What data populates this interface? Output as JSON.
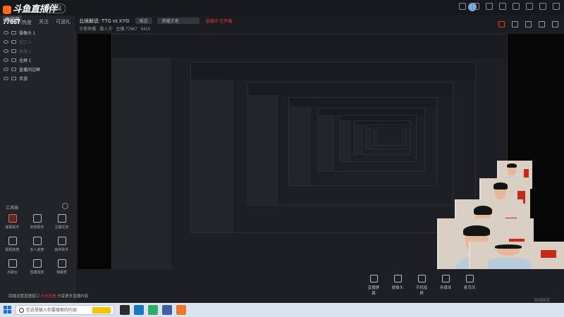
{
  "app": {
    "logo_text": "斗鱼直播伴侣",
    "badge": "未认证"
  },
  "sidebar": {
    "room_tag": "房间号",
    "stats": [
      {
        "value": "77667",
        "label": "热度"
      },
      {
        "label": "关注"
      },
      {
        "label": "可送礼"
      }
    ],
    "scenes": [
      {
        "label": "摄像头 1",
        "dim": false
      },
      {
        "label": "窗口 1",
        "dim": true
      },
      {
        "label": "图像 1",
        "dim": true
      },
      {
        "label": "全屏 1",
        "dim": false
      },
      {
        "label": "直播间边框",
        "dim": false
      },
      {
        "label": "手游",
        "dim": false
      }
    ],
    "toolbox_title": "工具箱",
    "tools": [
      {
        "label": "弹幕助手",
        "red": true
      },
      {
        "label": "房管助手",
        "red": false
      },
      {
        "label": "主播任务",
        "red": false
      },
      {
        "label": "视频连麦",
        "red": false
      },
      {
        "label": "多人连麦",
        "red": false
      },
      {
        "label": "抽奖助手",
        "red": false
      },
      {
        "label": "点歌台",
        "red": false
      },
      {
        "label": "直播回放",
        "red": false
      },
      {
        "label": "弹幕秀",
        "red": false
      }
    ]
  },
  "header": {
    "match_title": "北境解说: TTG vs XYG",
    "chip1": "推送",
    "chip2": "荣耀王者",
    "red_text": "直播中 已开播",
    "sub": "王者荣耀 · 路人王",
    "sub2": "主播",
    "sub3": "77667",
    "sub4": "6410"
  },
  "controls": [
    {
      "label": "直播屏幕"
    },
    {
      "label": "摄像头"
    },
    {
      "label": "手机投屏"
    },
    {
      "label": "多媒体"
    },
    {
      "label": "麦克风"
    }
  ],
  "bottom_note": {
    "prefix": "回播设置直播窗口",
    "red": "点击查看",
    "suffix": "分享更多直播内容"
  },
  "bottom_right": "回调频道",
  "taskbar": {
    "search_placeholder": "在这里输入你要搜索的内容"
  }
}
